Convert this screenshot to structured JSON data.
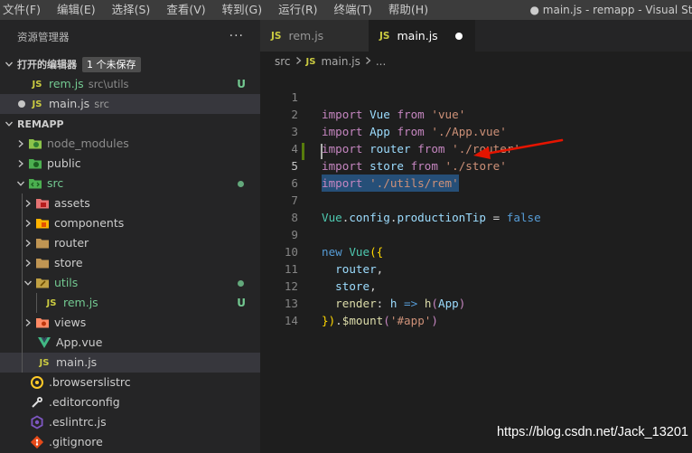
{
  "menubar": {
    "items": [
      "文件(F)",
      "编辑(E)",
      "选择(S)",
      "查看(V)",
      "转到(G)",
      "运行(R)",
      "终端(T)",
      "帮助(H)"
    ],
    "window_title": "● main.js - remapp - Visual Stu"
  },
  "explorer": {
    "title": "资源管理器",
    "more": "···",
    "open_editors": {
      "title": "打开的编辑器",
      "badge": "1 个未保存",
      "items": [
        {
          "name": "rem.js",
          "desc": "src\\utils",
          "git": "U"
        },
        {
          "name": "main.js",
          "desc": "src"
        }
      ]
    },
    "project": {
      "title": "REMAPP",
      "tree": [
        {
          "name": "node_modules",
          "icon": "folder-node-icon"
        },
        {
          "name": "public",
          "icon": "folder-public-icon"
        },
        {
          "name": "src",
          "icon": "folder-src-icon"
        },
        {
          "name": "assets",
          "icon": "folder-assets-icon"
        },
        {
          "name": "components",
          "icon": "folder-components-icon"
        },
        {
          "name": "router",
          "icon": "folder-icon"
        },
        {
          "name": "store",
          "icon": "folder-icon"
        },
        {
          "name": "utils",
          "icon": "folder-utils-icon"
        },
        {
          "name": "rem.js",
          "icon": "js-file-icon",
          "git": "U"
        },
        {
          "name": "views",
          "icon": "folder-views-icon"
        },
        {
          "name": "App.vue",
          "icon": "vue-file-icon"
        },
        {
          "name": "main.js",
          "icon": "js-file-icon"
        },
        {
          "name": ".browserslistrc",
          "icon": "browserslist-icon"
        },
        {
          "name": ".editorconfig",
          "icon": "editorconfig-icon"
        },
        {
          "name": ".eslintrc.js",
          "icon": "eslint-icon"
        },
        {
          "name": ".gitignore",
          "icon": "git-icon"
        }
      ]
    }
  },
  "editor": {
    "tabs": [
      {
        "label": "rem.js",
        "active": false
      },
      {
        "label": "main.js",
        "active": true,
        "dirty": true
      }
    ],
    "breadcrumb": {
      "folder": "src",
      "file": "main.js",
      "tail": "..."
    },
    "line_numbers": [
      "1",
      "2",
      "3",
      "4",
      "5",
      "6",
      "7",
      "8",
      "9",
      "10",
      "11",
      "12",
      "13",
      "14"
    ],
    "current_line": "5",
    "code": [
      "import Vue from 'vue'",
      "import App from './App.vue'",
      "import router from './router'",
      "import store from './store'",
      "import './utils/rem'",
      "",
      "Vue.config.productionTip = false",
      "",
      "new Vue({",
      "  router,",
      "  store,",
      "  render: h => h(App)",
      "}).$mount('#app')",
      ""
    ]
  },
  "watermark": "https://blog.csdn.net/Jack_13201",
  "colors": {
    "accent_arrow": "#e51400",
    "git_untracked": "#73c991",
    "selection": "#264f78"
  }
}
